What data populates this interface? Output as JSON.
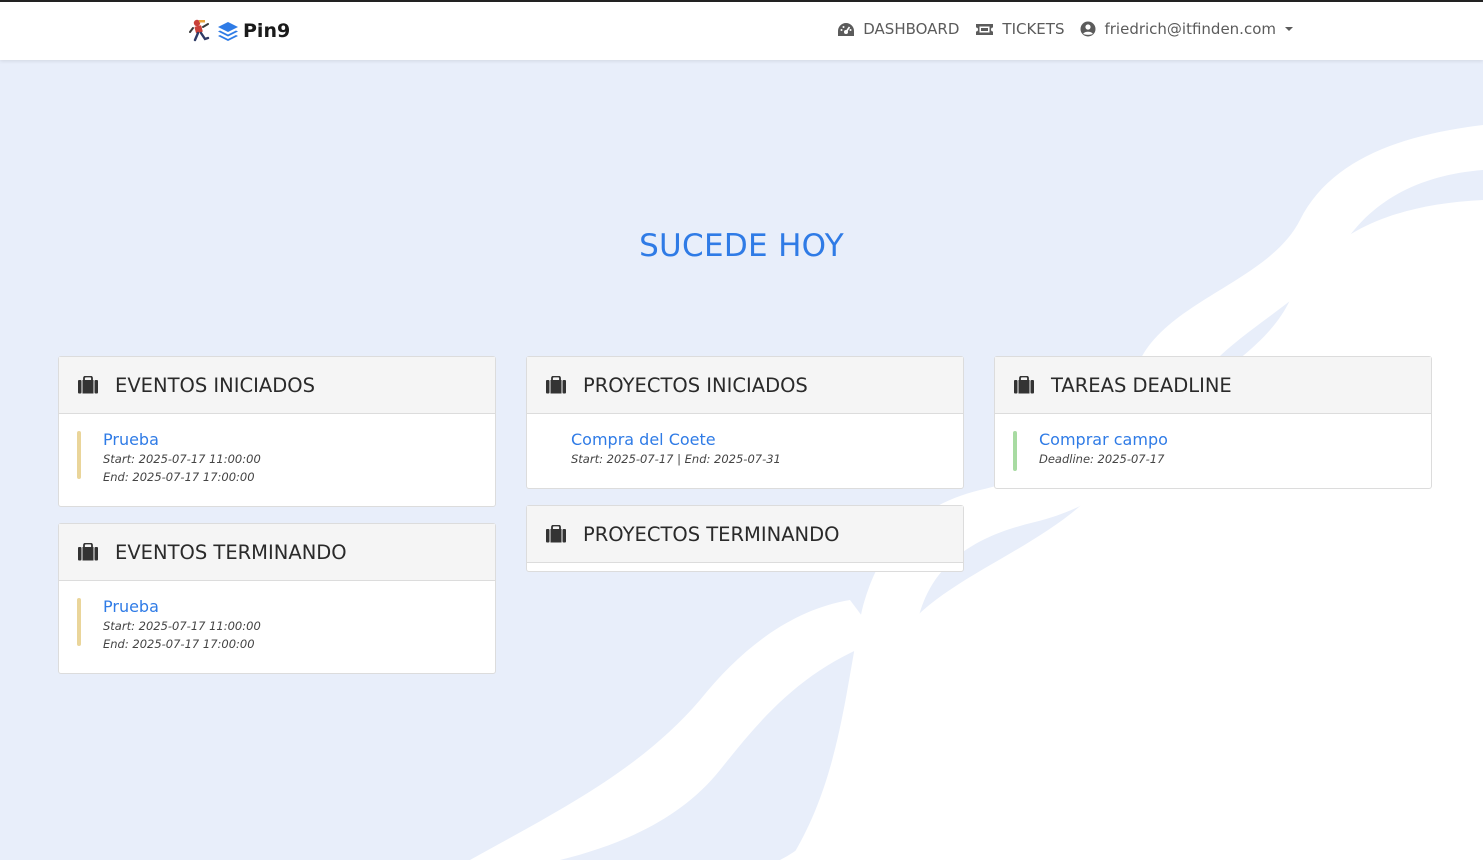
{
  "brand": {
    "name": "Pin9"
  },
  "nav": {
    "dashboard": "DASHBOARD",
    "tickets": "TICKETS",
    "user": "friedrich@itfinden.com"
  },
  "page": {
    "heading": "SUCEDE HOY"
  },
  "cards": {
    "eventos_iniciados": {
      "title": "EVENTOS INICIADOS",
      "items": [
        {
          "name": "Prueba",
          "start": "Start: 2025-07-17 11:00:00",
          "end": "End: 2025-07-17 17:00:00"
        }
      ]
    },
    "eventos_terminando": {
      "title": "EVENTOS TERMINANDO",
      "items": [
        {
          "name": "Prueba",
          "start": "Start: 2025-07-17 11:00:00",
          "end": "End: 2025-07-17 17:00:00"
        }
      ]
    },
    "proyectos_iniciados": {
      "title": "PROYECTOS INICIADOS",
      "items": [
        {
          "name": "Compra del Coete",
          "dates": "Start: 2025-07-17 | End: 2025-07-31"
        }
      ]
    },
    "proyectos_terminando": {
      "title": "PROYECTOS TERMINANDO",
      "items": []
    },
    "tareas_deadline": {
      "title": "TAREAS DEADLINE",
      "items": [
        {
          "name": "Comprar campo",
          "deadline": "Deadline: 2025-07-17"
        }
      ]
    }
  },
  "colors": {
    "accent": "#2f7be6",
    "background": "#e8eefa",
    "event_bar": "#ead59a",
    "task_bar": "#a8dba2"
  }
}
